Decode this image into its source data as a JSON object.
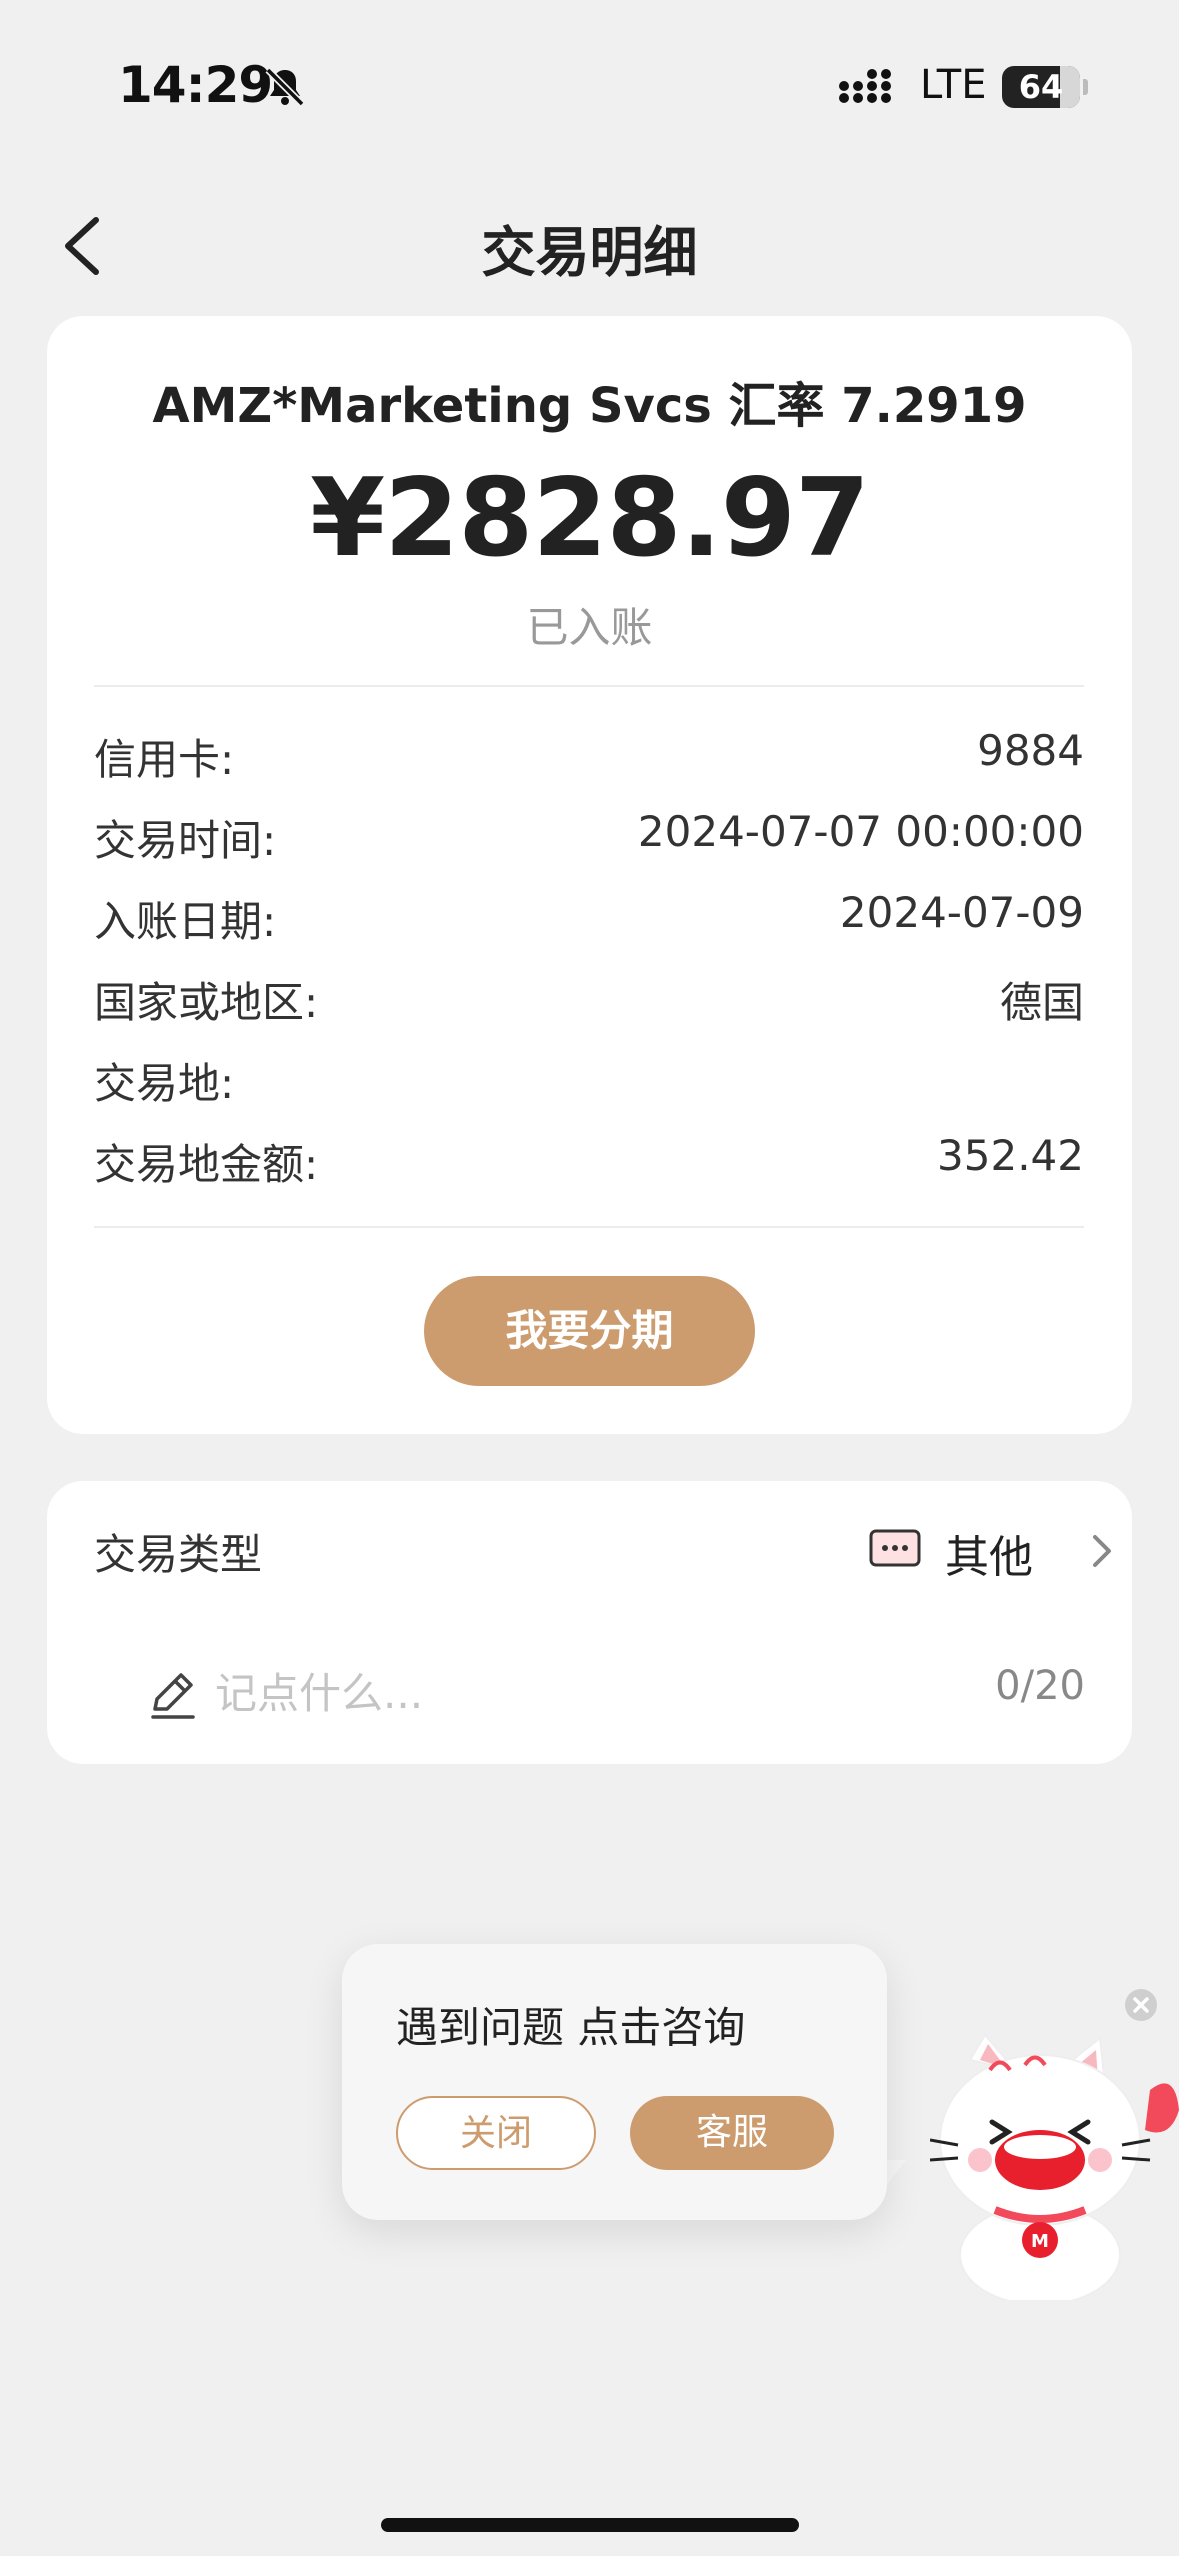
{
  "status_bar": {
    "time": "14:29",
    "network": "LTE",
    "battery": "64"
  },
  "header": {
    "title": "交易明细"
  },
  "summary": {
    "merchant_line": "AMZ*Marketing Svcs 汇率 7.2919",
    "amount": "¥2828.97",
    "status": "已入账"
  },
  "details": [
    {
      "label": "信用卡:",
      "value": "9884"
    },
    {
      "label": "交易时间:",
      "value": "2024-07-07 00:00:00"
    },
    {
      "label": "入账日期:",
      "value": "2024-07-09"
    },
    {
      "label": "国家或地区:",
      "value": "德国"
    },
    {
      "label": "交易地:",
      "value": ""
    },
    {
      "label": "交易地金额:",
      "value": "352.42"
    }
  ],
  "installment_button": "我要分期",
  "transaction_type": {
    "label": "交易类型",
    "value": "其他",
    "icon": "more-dots-icon",
    "icon_color": "#e8485a"
  },
  "note": {
    "placeholder": "记点什么...",
    "value": "",
    "counter": "0/20"
  },
  "consult_popup": {
    "text": "遇到问题 点击咨询",
    "close_label": "关闭",
    "service_label": "客服"
  },
  "colors": {
    "accent": "#cc9c6e",
    "background": "#f0f0f0",
    "card": "#ffffff"
  }
}
